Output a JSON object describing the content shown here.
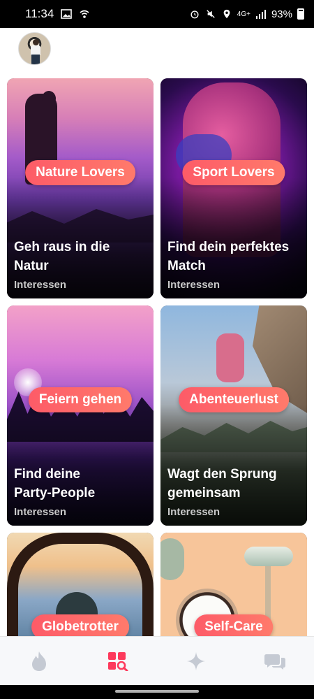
{
  "status_bar": {
    "time": "11:34",
    "signal_label": "4G+",
    "battery": "93%"
  },
  "header": {
    "avatar_icon": "profile-avatar"
  },
  "cards": [
    {
      "badge": "Nature Lovers",
      "title_line1": "Geh raus in die",
      "title_line2": "Natur",
      "subtitle": "Interessen"
    },
    {
      "badge": "Sport Lovers",
      "title_line1": "Find dein perfektes",
      "title_line2": "Match",
      "subtitle": "Interessen"
    },
    {
      "badge": "Feiern gehen",
      "title_line1": "Find deine",
      "title_line2": "Party-People",
      "subtitle": "Interessen"
    },
    {
      "badge": "Abenteuerlust",
      "title_line1": "Wagt den Sprung",
      "title_line2": "gemeinsam",
      "subtitle": "Interessen"
    },
    {
      "badge": "Globetrotter",
      "title_line1": "",
      "title_line2": "",
      "subtitle": ""
    },
    {
      "badge": "Self-Care",
      "title_line1": "",
      "title_line2": "",
      "subtitle": ""
    }
  ],
  "bottom_nav": {
    "items": [
      {
        "icon": "flame-icon",
        "active": false
      },
      {
        "icon": "explore-icon",
        "active": true
      },
      {
        "icon": "sparkle-icon",
        "active": false
      },
      {
        "icon": "chat-icon",
        "active": false
      }
    ],
    "active_color": "#fd3a5c",
    "inactive_color": "#c5cad3"
  }
}
